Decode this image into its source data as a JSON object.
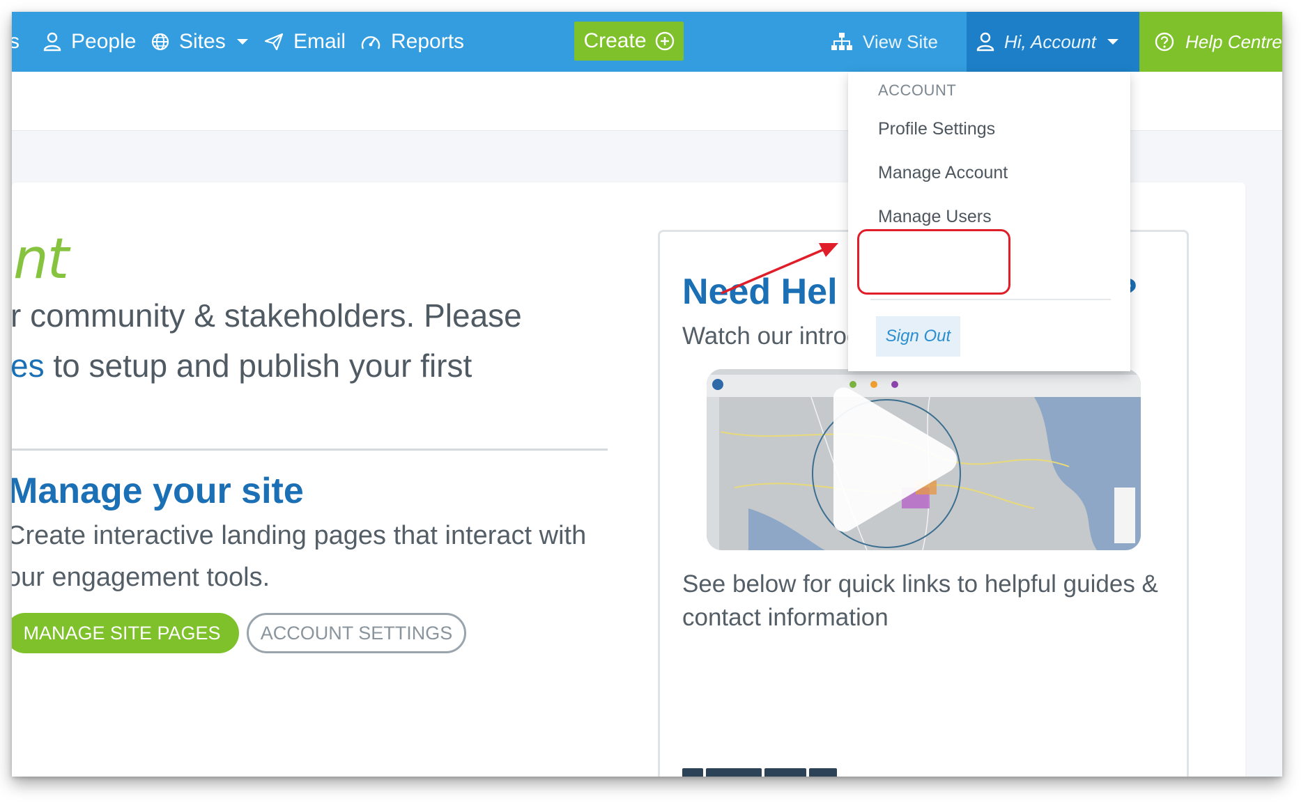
{
  "topbar": {
    "partial_item_label": "s",
    "people_label": "People",
    "sites_label": "Sites",
    "email_label": "Email",
    "reports_label": "Reports",
    "create_label": "Create",
    "view_site_label": "View Site",
    "account_label": "Hi, Account",
    "help_label": "Help Centre"
  },
  "dropdown": {
    "header": "ACCOUNT",
    "items": [
      "Profile Settings",
      "Manage Account",
      "Manage Users"
    ],
    "signout_label": "Sign Out"
  },
  "hero": {
    "title_partial": "nt",
    "line1": "r community & stakeholders. Please",
    "line2_link": "es",
    "line2_rest": " to setup and publish your first"
  },
  "manage_site": {
    "title": "Manage your site",
    "description": "Create interactive landing pages that interact with our engagement tools.",
    "primary_button": "MANAGE SITE PAGES",
    "secondary_button": "ACCOUNT SETTINGS"
  },
  "help_panel": {
    "title_left": "Need Hel",
    "title_right": "l?",
    "subtitle": "Watch our introductory video below",
    "links_text": "See below for quick links to helpful guides & contact information"
  },
  "colors": {
    "nav_blue": "#339ddf",
    "account_blue": "#1d7fc7",
    "brand_green": "#7ec12a",
    "heading_blue": "#1a6fb5",
    "highlight_red": "#e01e2a"
  }
}
